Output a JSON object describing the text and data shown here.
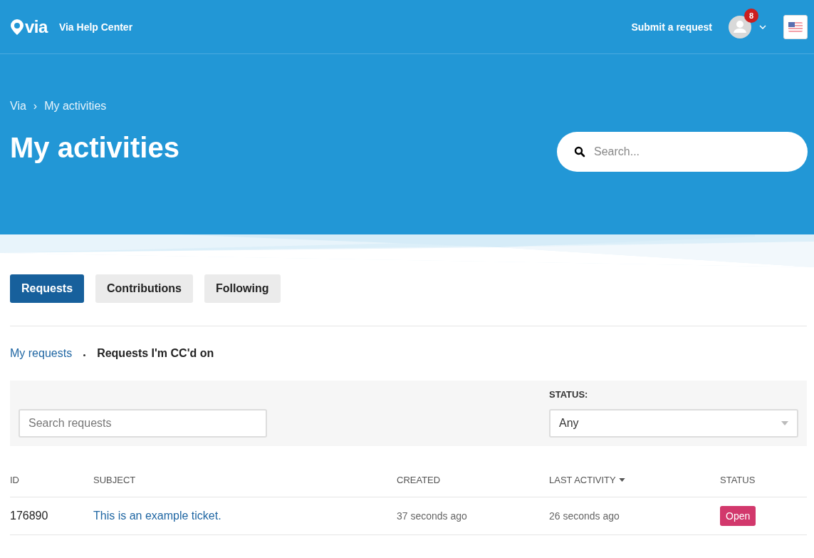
{
  "header": {
    "logo_text": "via",
    "brand": "Via Help Center",
    "submit_link": "Submit a request",
    "notification_count": "8"
  },
  "breadcrumbs": [
    "Via",
    "My activities"
  ],
  "breadcrumb_separator": "›",
  "title": "My activities",
  "search": {
    "placeholder": "Search..."
  },
  "tabs": [
    {
      "label": "Requests",
      "selected": true
    },
    {
      "label": "Contributions",
      "selected": false
    },
    {
      "label": "Following",
      "selected": false
    }
  ],
  "subtabs": [
    {
      "label": "My requests",
      "selected": false
    },
    {
      "label": "Requests I'm CC'd on",
      "selected": true
    }
  ],
  "filters": {
    "search_placeholder": "Search requests",
    "status_label": "STATUS:",
    "status_value": "Any"
  },
  "table": {
    "columns": [
      {
        "label": "ID",
        "sorted": false
      },
      {
        "label": "SUBJECT",
        "sorted": false
      },
      {
        "label": "CREATED",
        "sorted": false
      },
      {
        "label": "LAST ACTIVITY",
        "sorted": true
      },
      {
        "label": "STATUS",
        "sorted": false
      }
    ],
    "rows": [
      {
        "id": "176890",
        "subject": "This is an example ticket.",
        "created": "37 seconds ago",
        "last_activity": "26 seconds ago",
        "status": "Open",
        "color": "#d2386c"
      }
    ]
  }
}
